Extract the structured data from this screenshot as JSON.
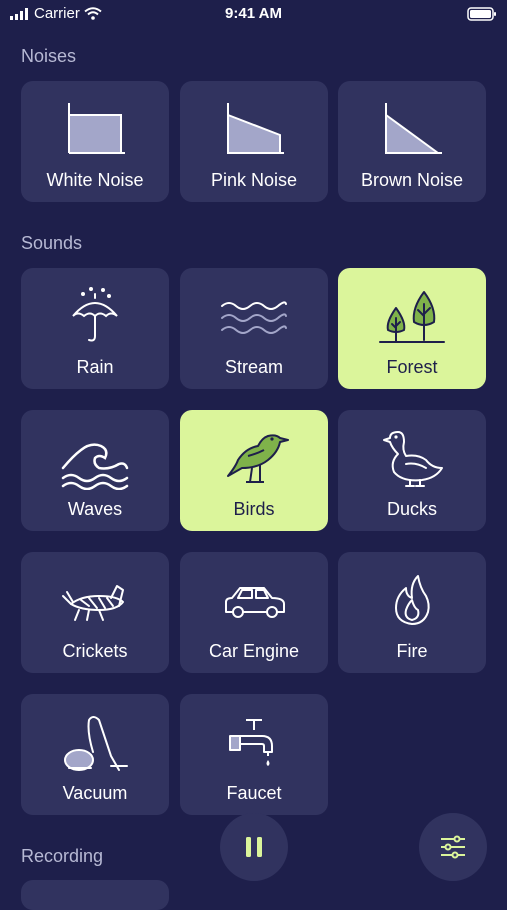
{
  "status_bar": {
    "carrier": "Carrier",
    "time": "9:41 AM"
  },
  "sections": {
    "noises_title": "Noises",
    "sounds_title": "Sounds",
    "recording_title": "Recording"
  },
  "noises": [
    {
      "label": "White Noise",
      "icon": "white-noise-icon",
      "active": false
    },
    {
      "label": "Pink Noise",
      "icon": "pink-noise-icon",
      "active": false
    },
    {
      "label": "Brown Noise",
      "icon": "brown-noise-icon",
      "active": false
    }
  ],
  "sounds": [
    {
      "label": "Rain",
      "icon": "umbrella-icon",
      "active": false
    },
    {
      "label": "Stream",
      "icon": "stream-icon",
      "active": false
    },
    {
      "label": "Forest",
      "icon": "trees-icon",
      "active": true
    },
    {
      "label": "Waves",
      "icon": "wave-icon",
      "active": false
    },
    {
      "label": "Birds",
      "icon": "bird-icon",
      "active": true
    },
    {
      "label": "Ducks",
      "icon": "duck-icon",
      "active": false
    },
    {
      "label": "Crickets",
      "icon": "cricket-icon",
      "active": false
    },
    {
      "label": "Car Engine",
      "icon": "car-icon",
      "active": false
    },
    {
      "label": "Fire",
      "icon": "flame-icon",
      "active": false
    },
    {
      "label": "Vacuum",
      "icon": "vacuum-icon",
      "active": false
    },
    {
      "label": "Faucet",
      "icon": "faucet-icon",
      "active": false
    }
  ],
  "controls": {
    "pause_icon": "pause-icon",
    "settings_icon": "sliders-icon"
  },
  "colors": {
    "background": "#1e1f4b",
    "tile": "#31335f",
    "active": "#dbf59b",
    "icon_stroke": "#ffffff"
  }
}
